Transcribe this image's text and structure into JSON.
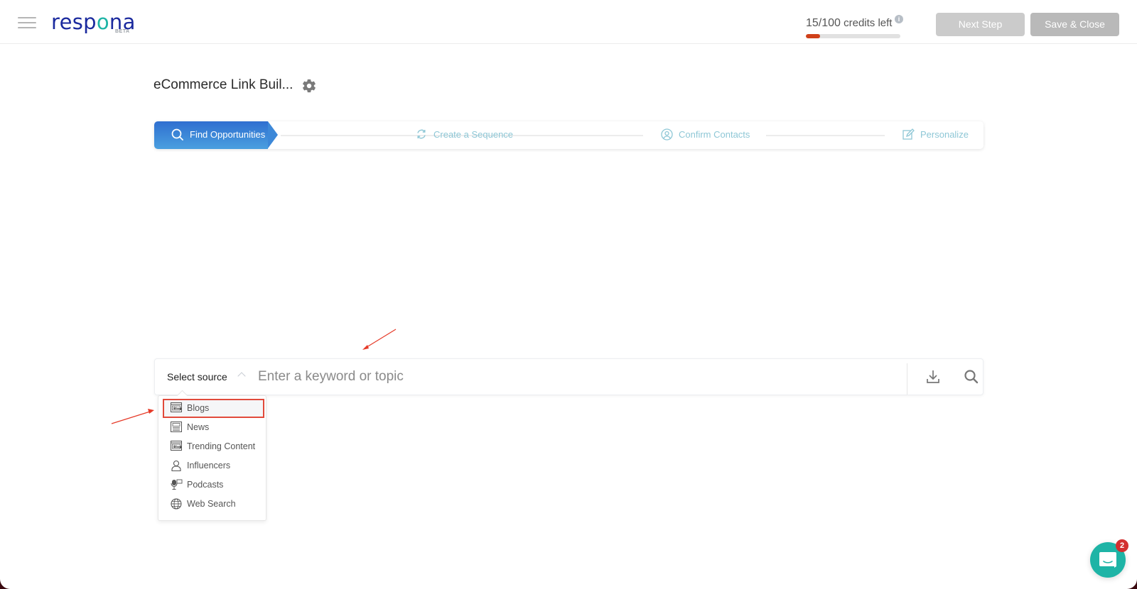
{
  "app": {
    "logo_text_pre": "resp",
    "logo_text_o": "o",
    "logo_text_post": "na",
    "logo_badge": "BETA",
    "brand_color": "#1b2a9e",
    "accent_color": "#1eb4a6"
  },
  "header": {
    "credits_number": "15/100",
    "credits_suffix": " credits left",
    "credits_used_fraction": 0.15,
    "info_icon": "i",
    "next_step_label": "Next Step",
    "save_close_label": "Save & Close"
  },
  "campaign": {
    "title": "eCommerce Link Buil..."
  },
  "stepper": {
    "steps": [
      {
        "label": "Find Opportunities",
        "icon": "search-icon",
        "active": true
      },
      {
        "label": "Create a Sequence",
        "icon": "refresh-icon",
        "active": false
      },
      {
        "label": "Confirm Contacts",
        "icon": "user-circle-icon",
        "active": false
      },
      {
        "label": "Personalize",
        "icon": "edit-icon",
        "active": false
      }
    ]
  },
  "search": {
    "source_label": "Select source",
    "keyword_placeholder": "Enter a keyword or topic",
    "keyword_value": ""
  },
  "source_dropdown": {
    "items": [
      {
        "label": "Blogs",
        "icon": "blog-icon",
        "highlighted": true
      },
      {
        "label": "News",
        "icon": "newspaper-icon",
        "highlighted": false
      },
      {
        "label": "Trending Content",
        "icon": "blog-icon",
        "highlighted": false
      },
      {
        "label": "Influencers",
        "icon": "person-icon",
        "highlighted": false
      },
      {
        "label": "Podcasts",
        "icon": "microphone-icon",
        "highlighted": false
      },
      {
        "label": "Web Search",
        "icon": "globe-icon",
        "highlighted": false
      }
    ]
  },
  "chat": {
    "badge_count": "2"
  }
}
